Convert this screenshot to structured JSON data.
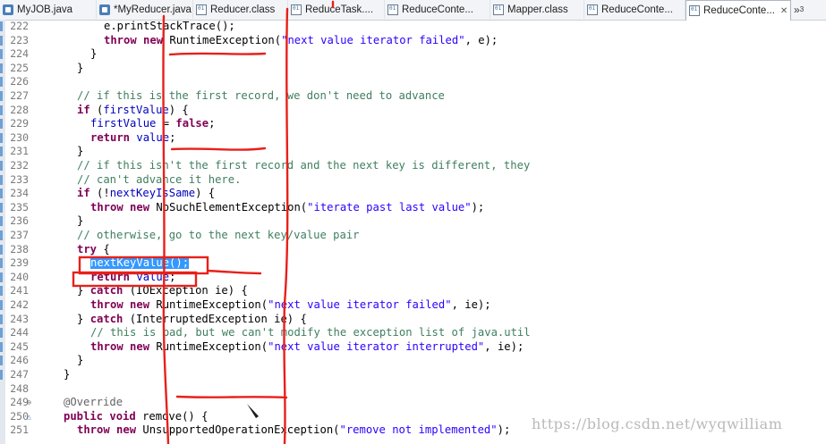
{
  "tabs": [
    {
      "label": "MyJOB.java",
      "type": "java"
    },
    {
      "label": "*MyReducer.java",
      "type": "java"
    },
    {
      "label": "Reducer.class",
      "type": "class"
    },
    {
      "label": "ReduceTask....",
      "type": "class"
    },
    {
      "label": "ReduceConte...",
      "type": "class"
    },
    {
      "label": "Mapper.class",
      "type": "class"
    },
    {
      "label": "ReduceConte...",
      "type": "class"
    },
    {
      "label": "ReduceConte...",
      "type": "class",
      "active": true
    }
  ],
  "tab_close_glyph": "✕",
  "tab_overflow": {
    "label": "»",
    "count": "3"
  },
  "editor": {
    "lines": [
      {
        "num": "222",
        "text": "e.printStackTrace();"
      },
      {
        "num": "223",
        "text": "throw new RuntimeException(\"next value iterator failed\", e);"
      },
      {
        "num": "224",
        "text": "}"
      },
      {
        "num": "225",
        "text": "}"
      },
      {
        "num": "226",
        "text": ""
      },
      {
        "num": "227",
        "text": "// if this is the first record, we don't need to advance"
      },
      {
        "num": "228",
        "text": "if (firstValue) {"
      },
      {
        "num": "229",
        "text": "firstValue = false;"
      },
      {
        "num": "230",
        "text": "return value;"
      },
      {
        "num": "231",
        "text": "}"
      },
      {
        "num": "232",
        "text": "// if this isn't the first record and the next key is different, they"
      },
      {
        "num": "233",
        "text": "// can't advance it here."
      },
      {
        "num": "234",
        "text": "if (!nextKeyIsSame) {"
      },
      {
        "num": "235",
        "text": "throw new NoSuchElementException(\"iterate past last value\");"
      },
      {
        "num": "236",
        "text": "}"
      },
      {
        "num": "237",
        "text": "// otherwise, go to the next key/value pair"
      },
      {
        "num": "238",
        "text": "try {"
      },
      {
        "num": "239",
        "text": "nextKeyValue();"
      },
      {
        "num": "240",
        "text": "return value;"
      },
      {
        "num": "241",
        "text": "} catch (IOException ie) {"
      },
      {
        "num": "242",
        "text": "throw new RuntimeException(\"next value iterator failed\", ie);"
      },
      {
        "num": "243",
        "text": "} catch (InterruptedException ie) {"
      },
      {
        "num": "244",
        "text": "// this is bad, but we can't modify the exception list of java.util"
      },
      {
        "num": "245",
        "text": "throw new RuntimeException(\"next value iterator interrupted\", ie);"
      },
      {
        "num": "246",
        "text": "}"
      },
      {
        "num": "247",
        "text": "}"
      },
      {
        "num": "248",
        "text": ""
      },
      {
        "num": "249",
        "text": "@Override"
      },
      {
        "num": "250",
        "text": "public void remove() {"
      },
      {
        "num": "251",
        "text": "throw new UnsupportedOperationException(\"remove not implemented\");"
      }
    ]
  },
  "annotation_color": "#e8201a",
  "selection_color": "#3399ff",
  "watermark": "https://blog.csdn.net/wyqwilliam"
}
